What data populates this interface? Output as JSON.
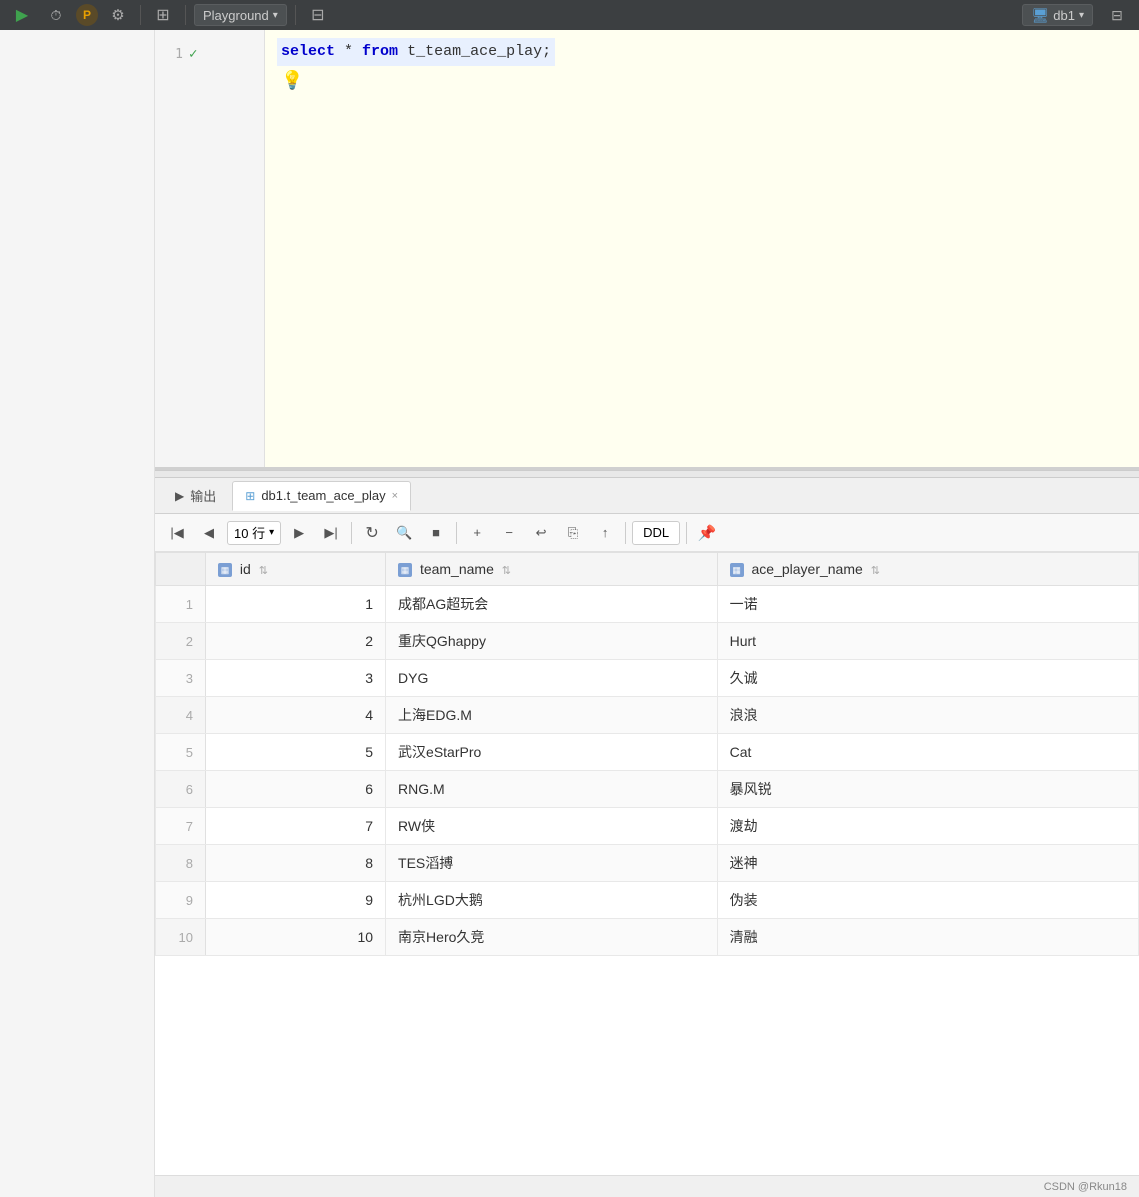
{
  "toolbar": {
    "play_label": "▶",
    "history_label": "⏱",
    "profile_label": "P",
    "settings_label": "🔧",
    "grid_label": "⊞",
    "playground_label": "Playground",
    "dropdown_arrow": "▾",
    "db_label": "db1",
    "db_icon": "🖥"
  },
  "editor": {
    "line1": {
      "num": "1",
      "sql": "select * from t_team_ace_play;"
    },
    "bulb": "💡"
  },
  "results": {
    "output_tab": "▶  输出",
    "table_tab": "db1.t_team_ace_play",
    "close_icon": "×",
    "toolbar": {
      "first": "|◀",
      "prev": "◀",
      "rows_label": "10 行",
      "rows_arrow": "▾",
      "next": "▶",
      "last": "▶|",
      "refresh": "↻",
      "search": "🔍",
      "stop": "■",
      "add": "+",
      "remove": "−",
      "undo": "↩",
      "clone": "⎘",
      "upload": "↑",
      "ddl": "DDL",
      "pin": "📌"
    },
    "columns": [
      {
        "name": "id",
        "sort": "⇅"
      },
      {
        "name": "team_name",
        "sort": "⇅"
      },
      {
        "name": "ace_player_name",
        "sort": "⇅"
      }
    ],
    "rows": [
      {
        "rownum": "1",
        "id": "1",
        "team_name": "成都AG超玩会",
        "ace_player_name": "一诺"
      },
      {
        "rownum": "2",
        "id": "2",
        "team_name": "重庆QGhappy",
        "ace_player_name": "Hurt"
      },
      {
        "rownum": "3",
        "id": "3",
        "team_name": "DYG",
        "ace_player_name": "久诚"
      },
      {
        "rownum": "4",
        "id": "4",
        "team_name": "上海EDG.M",
        "ace_player_name": "浪浪"
      },
      {
        "rownum": "5",
        "id": "5",
        "team_name": "武汉eStarPro",
        "ace_player_name": "Cat"
      },
      {
        "rownum": "6",
        "id": "6",
        "team_name": "RNG.M",
        "ace_player_name": "暴风锐"
      },
      {
        "rownum": "7",
        "id": "7",
        "team_name": "RW侠",
        "ace_player_name": "渡劫"
      },
      {
        "rownum": "8",
        "id": "8",
        "team_name": "TES滔搏",
        "ace_player_name": "迷神"
      },
      {
        "rownum": "9",
        "id": "9",
        "team_name": "杭州LGD大鹅",
        "ace_player_name": "伪装"
      },
      {
        "rownum": "10",
        "id": "10",
        "team_name": "南京Hero久竞",
        "ace_player_name": "清融"
      }
    ]
  },
  "status_bar": {
    "text": "CSDN @Rkun18"
  }
}
